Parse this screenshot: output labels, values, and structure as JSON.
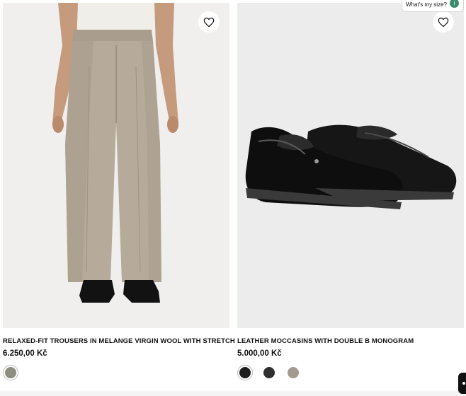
{
  "products": [
    {
      "title": "RELAXED-FIT TROUSERS IN MELANGE VIRGIN WOOL WITH STRETCH",
      "price": "6.250,00 Kč",
      "image_alt": "trousers-photo",
      "wishlist_icon": "heart-outline-icon",
      "colors": [
        {
          "hex": "#8d8e80",
          "selected": true
        }
      ]
    },
    {
      "title": "LEATHER MOCCASINS WITH DOUBLE B MONOGRAM",
      "price": "5.000,00 Kč",
      "image_alt": "moccasins-photo",
      "wishlist_icon": "heart-outline-icon",
      "colors": [
        {
          "hex": "#1c1c1c",
          "selected": true
        },
        {
          "hex": "#2f2f2f",
          "selected": false
        },
        {
          "hex": "#a59a90",
          "selected": false
        }
      ]
    }
  ],
  "size_helper": {
    "label": "What's my size?",
    "badge_icon": "info-icon"
  },
  "chat": {
    "icon": "chat-icon"
  }
}
